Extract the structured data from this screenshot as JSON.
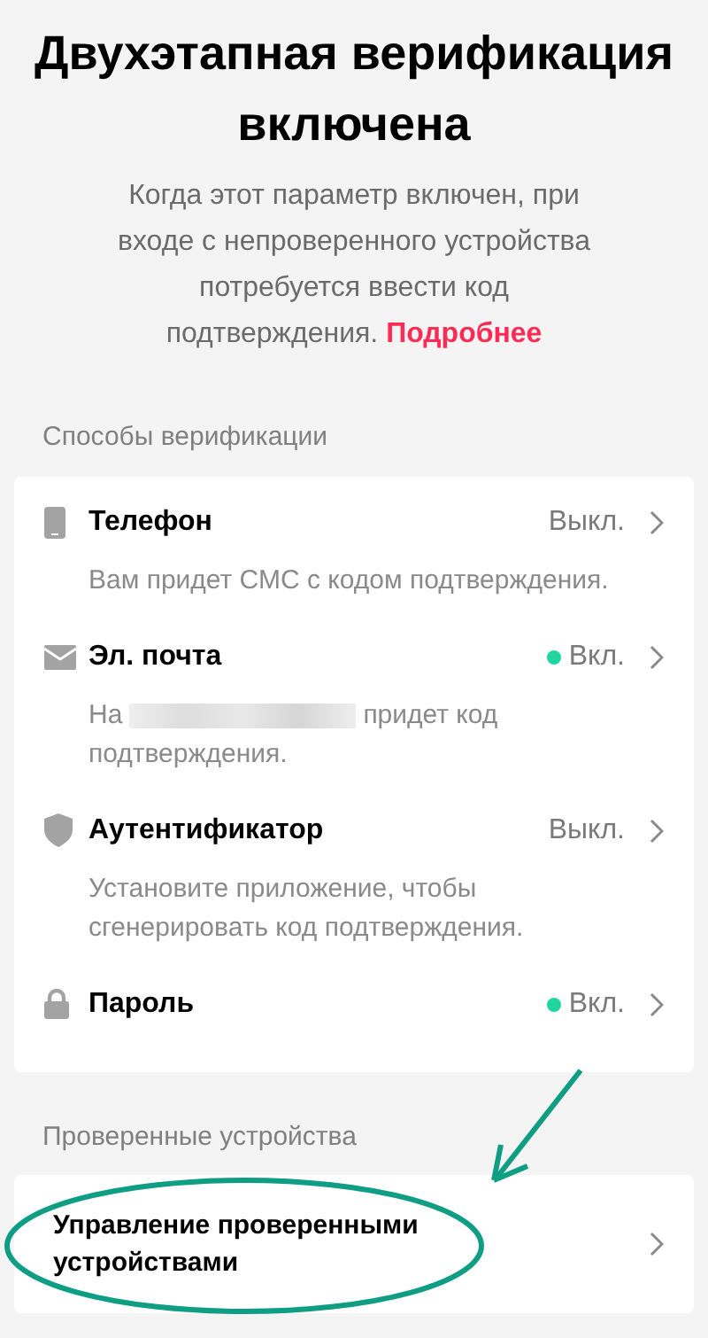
{
  "header": {
    "title": "Двухэтапная верификация включена",
    "description": "Когда этот параметр включен, при входе с непроверенного устройства потребуется ввести код подтверждения.",
    "link": "Подробнее"
  },
  "methods": {
    "heading": "Способы верификации",
    "items": [
      {
        "kind": "phone",
        "name": "Телефон",
        "status": "Выкл.",
        "on": false,
        "description": "Вам придет СМС с кодом подтверждения."
      },
      {
        "kind": "mail",
        "name": "Эл. почта",
        "status": "Вкл.",
        "on": true,
        "description_before": "На",
        "redacted": true,
        "description_after_blur": "придет код",
        "description": "подтверждения."
      },
      {
        "kind": "shield",
        "name": "Аутентификатор",
        "status": "Выкл.",
        "on": false,
        "description": "Установите приложение, чтобы сгенерировать код подтверждения."
      },
      {
        "kind": "lock",
        "name": "Пароль",
        "status": "Вкл.",
        "on": true
      }
    ]
  },
  "devices": {
    "heading": "Проверенные устройства",
    "items": [
      {
        "name": "Управление проверенными устройствами"
      }
    ]
  },
  "annotations": [
    {
      "kind": "ellipse"
    },
    {
      "kind": "arrow"
    }
  ]
}
